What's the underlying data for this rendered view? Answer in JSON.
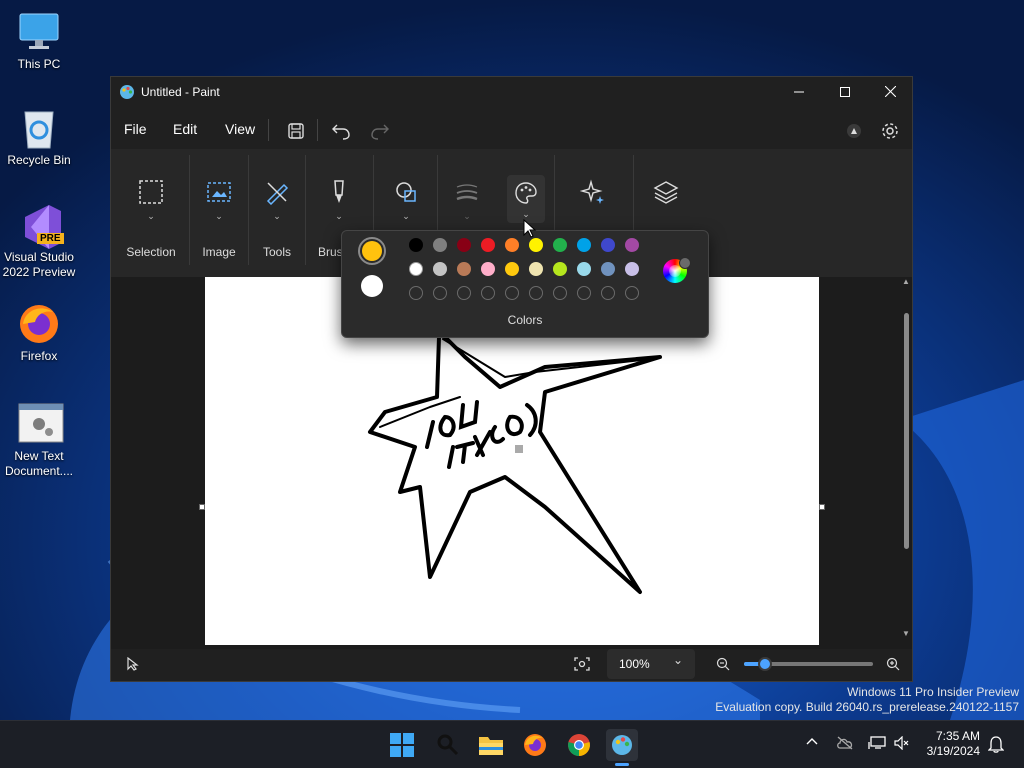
{
  "desktop": {
    "icons": [
      {
        "label": "This PC"
      },
      {
        "label": "Recycle Bin"
      },
      {
        "label": "Visual Studio 2022 Preview",
        "badge": "PRE"
      },
      {
        "label": "Firefox"
      },
      {
        "label": "New Text Document...."
      }
    ]
  },
  "window": {
    "title": "Untitled - Paint",
    "menu": {
      "file": "File",
      "edit": "Edit",
      "view": "View"
    },
    "ribbon": {
      "selection": "Selection",
      "image": "Image",
      "tools": "Tools",
      "brushes": "Brushes"
    },
    "colors_flyout": {
      "title": "Colors",
      "primary_color": "#ffc20e",
      "secondary_color": "#ffffff",
      "row1": [
        "#000000",
        "#7f7f7f",
        "#880015",
        "#ed1c24",
        "#ff7f27",
        "#fff200",
        "#22b14c",
        "#00a2e8",
        "#3f48cc",
        "#a349a4"
      ],
      "row2": [
        "#ffffff",
        "#c3c3c3",
        "#b97a57",
        "#ffaec9",
        "#ffc90e",
        "#efe4b0",
        "#b5e61d",
        "#99d9ea",
        "#7092be",
        "#c8bfe7"
      ],
      "custom_slots": 10
    },
    "status": {
      "zoom": "100%"
    }
  },
  "watermark": {
    "line1": "Windows 11 Pro Insider Preview",
    "line2": "Evaluation copy. Build 26040.rs_prerelease.240122-1157"
  },
  "taskbar": {
    "time": "7:35 AM",
    "date": "3/19/2024"
  }
}
